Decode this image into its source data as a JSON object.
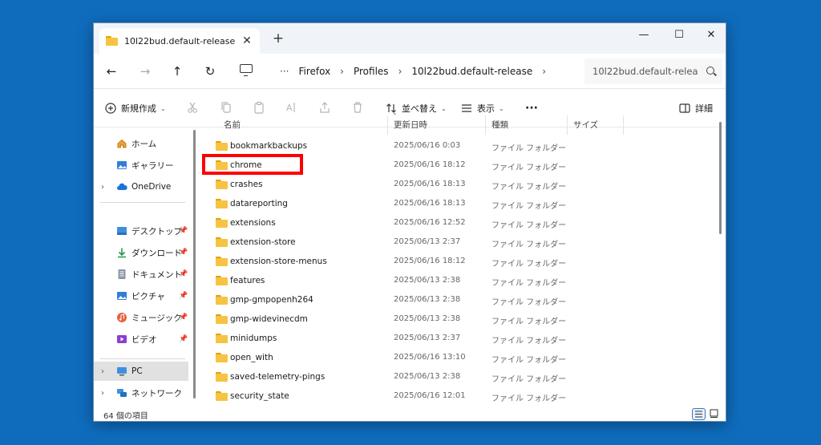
{
  "tab": {
    "title": "10l22bud.default-release",
    "close": "✕",
    "new": "+"
  },
  "window_controls": {
    "minimize": "—",
    "maximize": "☐",
    "close": "✕"
  },
  "nav": {
    "back": "←",
    "forward": "→",
    "up": "↑",
    "refresh": "↻",
    "more": "···"
  },
  "breadcrumb": [
    {
      "label": "Firefox",
      "sep": "›"
    },
    {
      "label": "Profiles",
      "sep": "›"
    },
    {
      "label": "10l22bud.default-release",
      "sep": "›"
    }
  ],
  "search": {
    "value": "10l22bud.default-relea"
  },
  "toolbar": {
    "new_label": "新規作成",
    "sort_label": "並べ替え",
    "view_label": "表示",
    "more": "···",
    "details_label": "詳細"
  },
  "sidebar": {
    "items": [
      {
        "label": "ホーム",
        "icon": "home-icon"
      },
      {
        "label": "ギャラリー",
        "icon": "gallery-icon"
      },
      {
        "label": "OneDrive",
        "icon": "cloud-icon"
      },
      {
        "label": "デスクトップ",
        "icon": "desktop-icon"
      },
      {
        "label": "ダウンロード",
        "icon": "download-icon"
      },
      {
        "label": "ドキュメント",
        "icon": "document-icon"
      },
      {
        "label": "ピクチャ",
        "icon": "pictures-icon"
      },
      {
        "label": "ミュージック",
        "icon": "music-icon"
      },
      {
        "label": "ビデオ",
        "icon": "video-icon"
      },
      {
        "label": "PC",
        "icon": "pc-icon"
      },
      {
        "label": "ネットワーク",
        "icon": "network-icon"
      }
    ]
  },
  "columns": {
    "name": "名前",
    "date": "更新日時",
    "type": "種類",
    "size": "サイズ"
  },
  "files": [
    {
      "name": "bookmarkbackups",
      "date": "2025/06/16 0:03",
      "type": "ファイル フォルダー"
    },
    {
      "name": "chrome",
      "date": "2025/06/16 18:12",
      "type": "ファイル フォルダー"
    },
    {
      "name": "crashes",
      "date": "2025/06/16 18:13",
      "type": "ファイル フォルダー"
    },
    {
      "name": "datareporting",
      "date": "2025/06/16 18:13",
      "type": "ファイル フォルダー"
    },
    {
      "name": "extensions",
      "date": "2025/06/16 12:52",
      "type": "ファイル フォルダー"
    },
    {
      "name": "extension-store",
      "date": "2025/06/13 2:37",
      "type": "ファイル フォルダー"
    },
    {
      "name": "extension-store-menus",
      "date": "2025/06/16 18:12",
      "type": "ファイル フォルダー"
    },
    {
      "name": "features",
      "date": "2025/06/13 2:38",
      "type": "ファイル フォルダー"
    },
    {
      "name": "gmp-gmpopenh264",
      "date": "2025/06/13 2:38",
      "type": "ファイル フォルダー"
    },
    {
      "name": "gmp-widevinecdm",
      "date": "2025/06/13 2:38",
      "type": "ファイル フォルダー"
    },
    {
      "name": "minidumps",
      "date": "2025/06/13 2:37",
      "type": "ファイル フォルダー"
    },
    {
      "name": "open_with",
      "date": "2025/06/16 13:10",
      "type": "ファイル フォルダー"
    },
    {
      "name": "saved-telemetry-pings",
      "date": "2025/06/13 2:38",
      "type": "ファイル フォルダー"
    },
    {
      "name": "security_state",
      "date": "2025/06/16 12:01",
      "type": "ファイル フォルダー"
    }
  ],
  "status": {
    "text": "64 個の項目"
  },
  "colors": {
    "accent": "#0f6cbd",
    "highlight": "#ff0000",
    "folder": "#f6c343"
  }
}
